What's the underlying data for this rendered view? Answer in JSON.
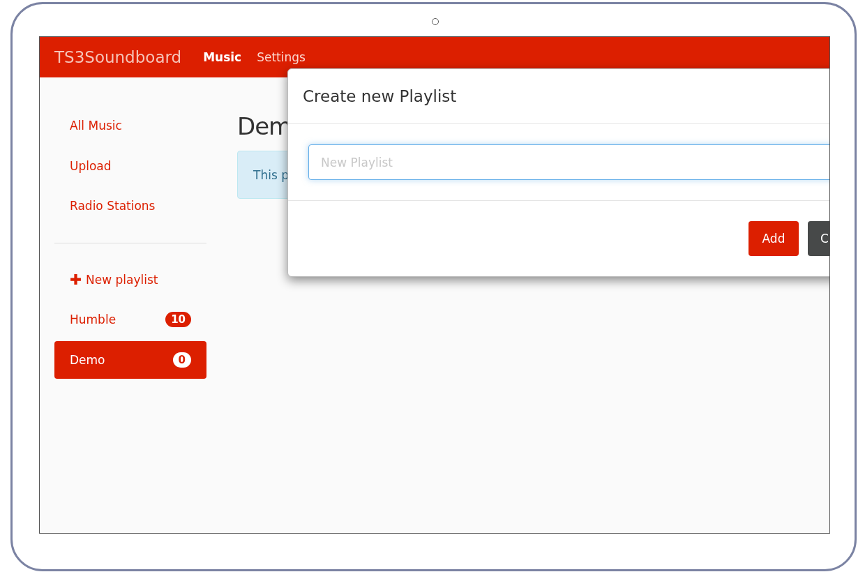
{
  "navbar": {
    "brand": "TS3Soundboard",
    "items": [
      {
        "label": "Music",
        "selected": true
      },
      {
        "label": "Settings",
        "selected": false
      }
    ]
  },
  "sidebar": {
    "items": [
      {
        "label": "All Music",
        "selected": false
      },
      {
        "label": "Upload",
        "selected": false
      },
      {
        "label": "Radio Stations",
        "selected": false
      }
    ],
    "new_playlist": "New playlist",
    "playlists": [
      {
        "label": "Humble",
        "count": "10",
        "selected": false
      },
      {
        "label": "Demo",
        "count": "0",
        "selected": true
      }
    ]
  },
  "page": {
    "heading": "Dem",
    "alert": "This p"
  },
  "modal": {
    "title": "Create new Playlist",
    "placeholder": "New Playlist",
    "buttons": [
      {
        "label": "Add",
        "kind": "primary"
      },
      {
        "label": "C",
        "kind": "secondary"
      }
    ]
  }
}
